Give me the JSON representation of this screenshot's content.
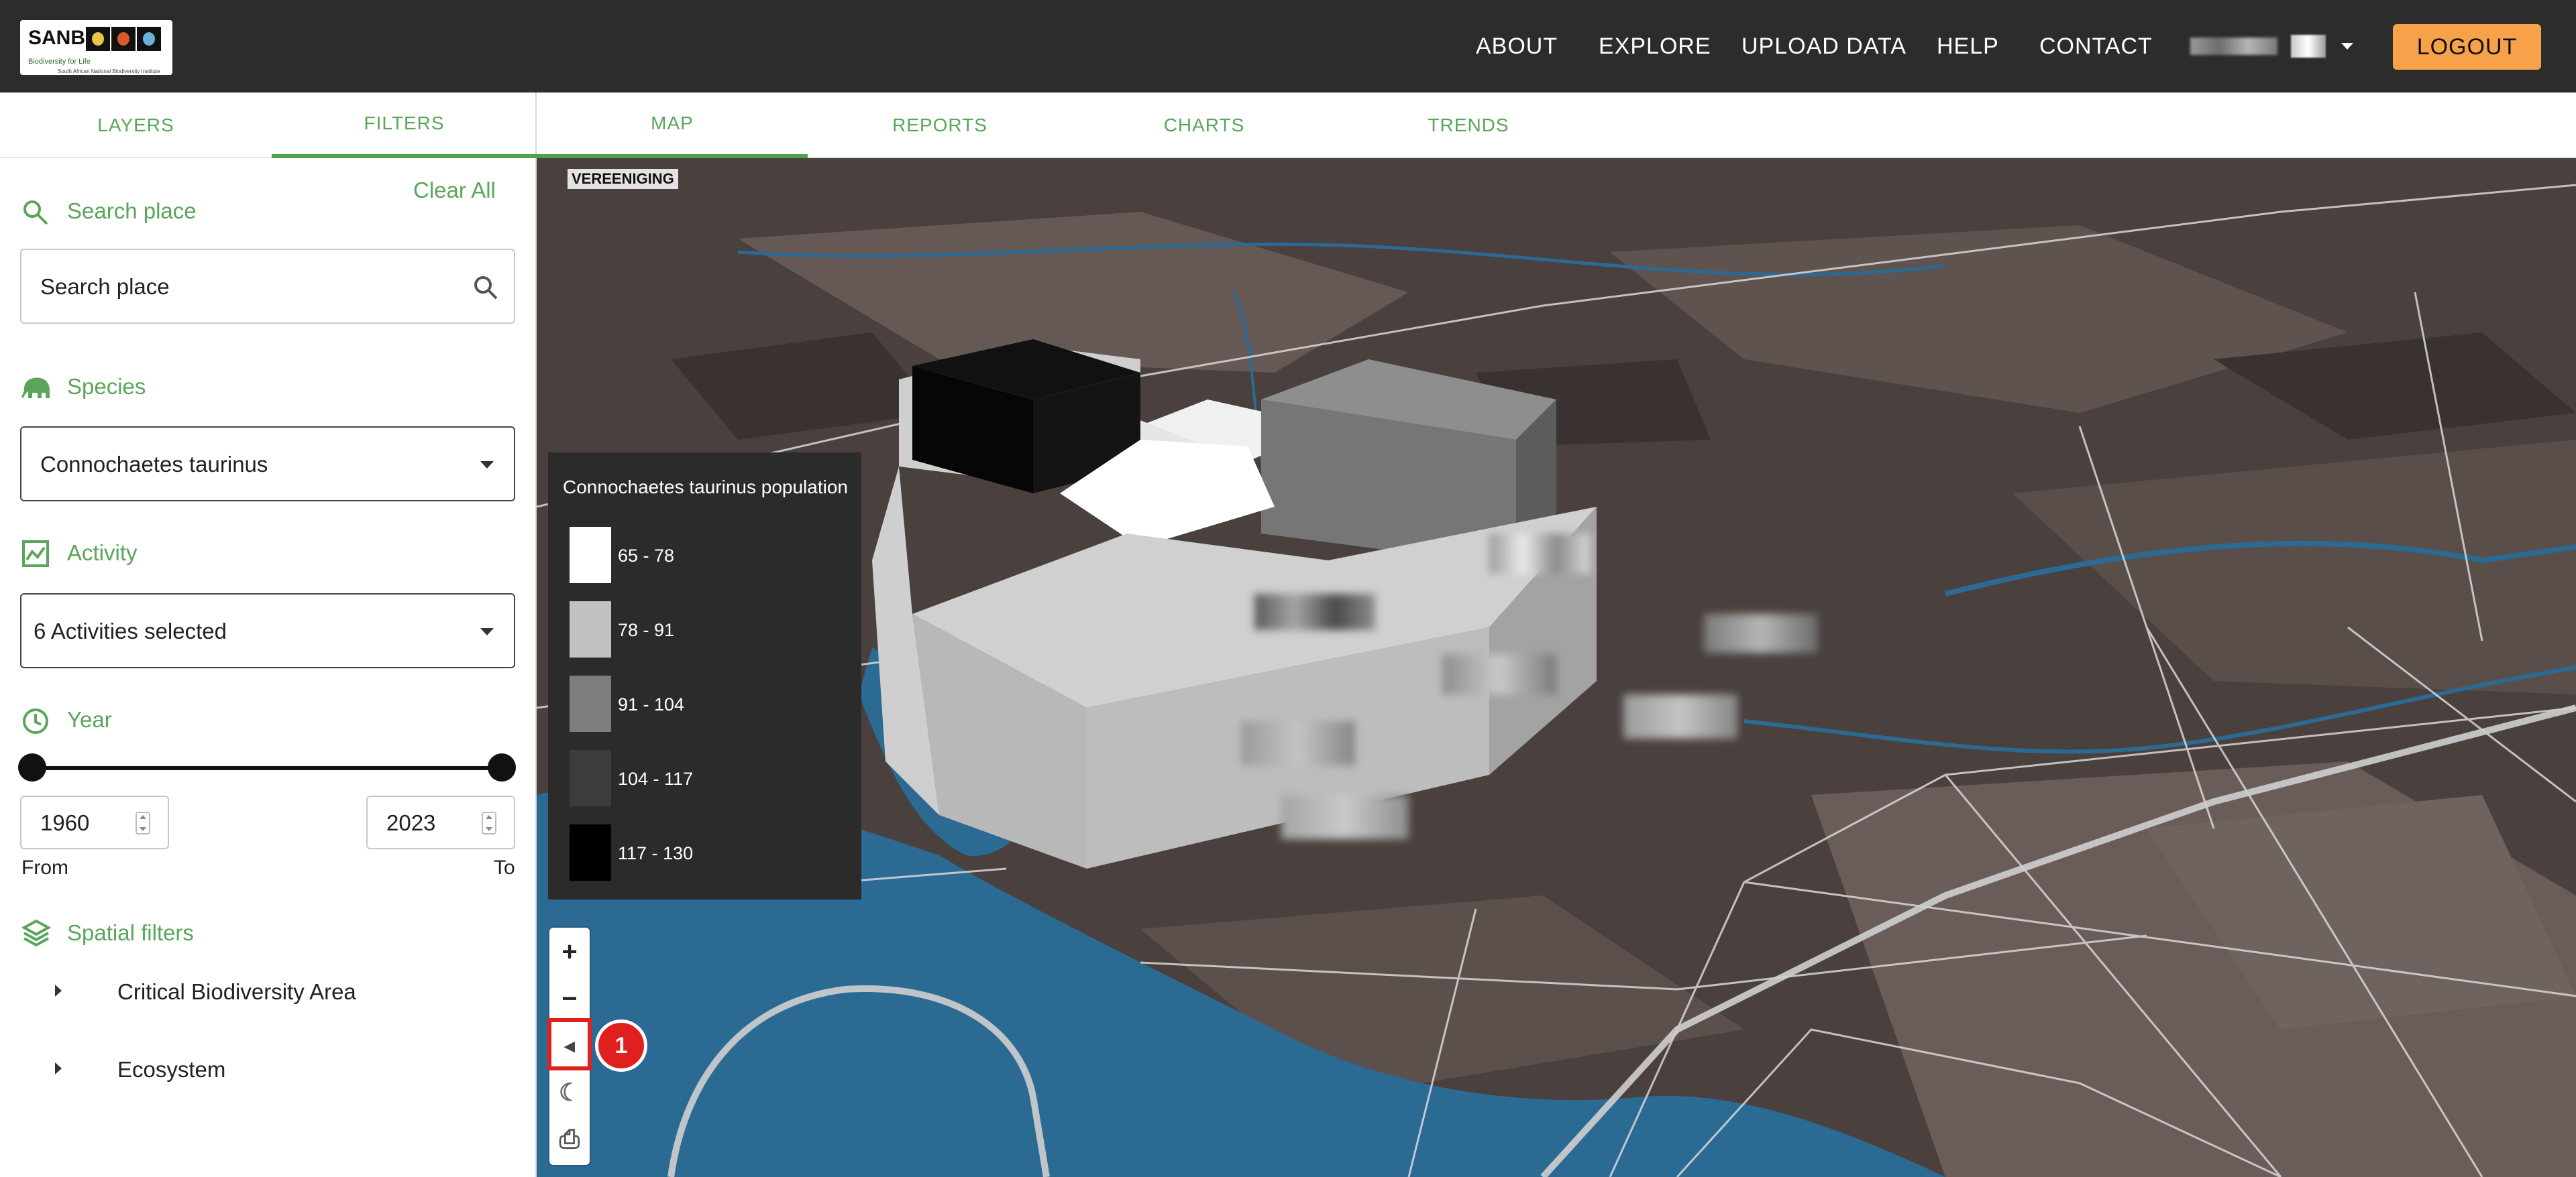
{
  "header": {
    "logo": {
      "title": "SANBI",
      "subtitle": "Biodiversity for Life",
      "org_name": "South African National Biodiversity Institute"
    },
    "nav": [
      "ABOUT",
      "EXPLORE",
      "UPLOAD DATA",
      "HELP",
      "CONTACT"
    ],
    "logout_label": "LOGOUT",
    "accent_color": "#f7a24a"
  },
  "left_panel": {
    "tabs": [
      {
        "label": "LAYERS",
        "active": false
      },
      {
        "label": "FILTERS",
        "active": true
      }
    ],
    "search_section_label": "Search place",
    "clear_all_label": "Clear All",
    "search_placeholder": "Search place",
    "species_label": "Species",
    "species_value": "Connochaetes taurinus",
    "activity_label": "Activity",
    "activity_value": "6 Activities selected",
    "year_label": "Year",
    "year_from": "1960",
    "year_to": "2023",
    "from_label": "From",
    "to_label": "To",
    "year_range_fraction": [
      0,
      1
    ],
    "spatial_filters_label": "Spatial filters",
    "spatial_filters": [
      "Critical Biodiversity Area",
      "Ecosystem"
    ]
  },
  "main_tabs": [
    {
      "label": "MAP",
      "active": true
    },
    {
      "label": "REPORTS",
      "active": false
    },
    {
      "label": "CHARTS",
      "active": false
    },
    {
      "label": "TRENDS",
      "active": false
    }
  ],
  "map": {
    "place_label": "VEREENIGING",
    "legend": {
      "title": "Connochaetes taurinus population",
      "items": [
        {
          "range": "65 - 78",
          "color": "#ffffff"
        },
        {
          "range": "78 - 91",
          "color": "#c2c2c2"
        },
        {
          "range": "91 - 104",
          "color": "#7d7d7d"
        },
        {
          "range": "104 - 117",
          "color": "#3c3c3c"
        },
        {
          "range": "117 - 130",
          "color": "#000000"
        }
      ]
    },
    "controls": [
      {
        "name": "zoom-in",
        "glyph": "+"
      },
      {
        "name": "zoom-out",
        "glyph": "−"
      },
      {
        "name": "compass",
        "glyph": "◂"
      },
      {
        "name": "dark-mode",
        "glyph": "☾"
      },
      {
        "name": "print",
        "glyph": "⎙"
      }
    ],
    "annotation_badge": "1",
    "colors": {
      "water": "#2b6a93",
      "land": "#4a403d",
      "highlight": "#e0201f"
    }
  }
}
